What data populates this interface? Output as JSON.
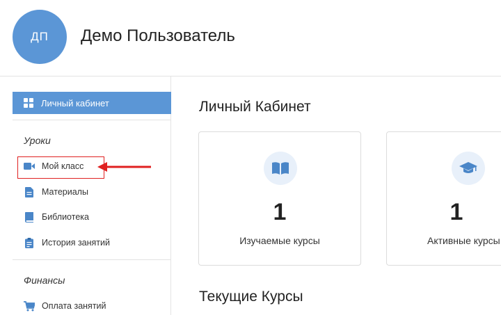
{
  "header": {
    "avatar_initials": "ДП",
    "username": "Демо Пользователь"
  },
  "sidebar": {
    "active_item": {
      "label": "Личный кабинет",
      "icon": "dashboard-grid-icon"
    },
    "sections": [
      {
        "title": "Уроки",
        "items": [
          {
            "label": "Мой класс",
            "icon": "video-camera-icon"
          },
          {
            "label": "Материалы",
            "icon": "document-icon"
          },
          {
            "label": "Библиотека",
            "icon": "book-icon"
          },
          {
            "label": "История занятий",
            "icon": "clipboard-icon"
          }
        ]
      },
      {
        "title": "Финансы",
        "items": [
          {
            "label": "Оплата занятий",
            "icon": "cart-icon"
          }
        ]
      }
    ]
  },
  "main": {
    "title": "Личный Кабинет",
    "cards": [
      {
        "value": "1",
        "label": "Изучаемые курсы",
        "icon": "open-book-icon"
      },
      {
        "value": "1",
        "label": "Активные курсы",
        "icon": "graduation-cap-icon"
      }
    ],
    "subtitle": "Текущие Курсы"
  },
  "colors": {
    "accent": "#5b96d6",
    "icon_blue": "#4a86c8",
    "annotation_red": "#e02020"
  }
}
